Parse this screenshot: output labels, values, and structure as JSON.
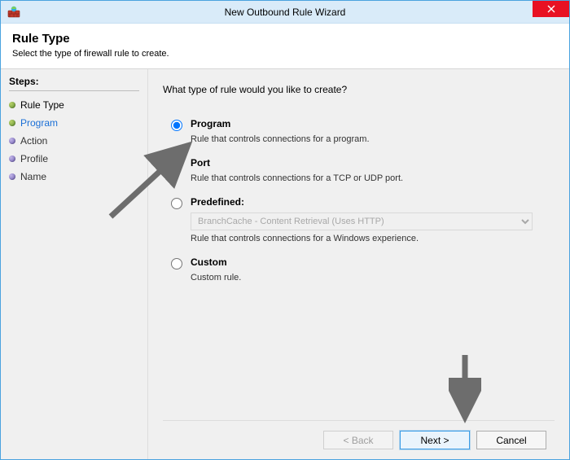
{
  "window": {
    "title": "New Outbound Rule Wizard"
  },
  "header": {
    "title": "Rule Type",
    "subtitle": "Select the type of firewall rule to create."
  },
  "sidebar": {
    "steps_label": "Steps:",
    "items": [
      {
        "label": "Rule Type",
        "state": "current"
      },
      {
        "label": "Program",
        "state": "link"
      },
      {
        "label": "Action",
        "state": "future"
      },
      {
        "label": "Profile",
        "state": "future"
      },
      {
        "label": "Name",
        "state": "future"
      }
    ]
  },
  "main": {
    "prompt": "What type of rule would you like to create?",
    "options": {
      "program": {
        "label": "Program",
        "desc": "Rule that controls connections for a program."
      },
      "port": {
        "label": "Port",
        "desc": "Rule that controls connections for a TCP or UDP port."
      },
      "predefined": {
        "label": "Predefined:",
        "desc": "Rule that controls connections for a Windows experience.",
        "select_value": "BranchCache - Content Retrieval (Uses HTTP)"
      },
      "custom": {
        "label": "Custom",
        "desc": "Custom rule."
      }
    },
    "selected": "program"
  },
  "footer": {
    "back": "< Back",
    "next": "Next >",
    "cancel": "Cancel"
  }
}
